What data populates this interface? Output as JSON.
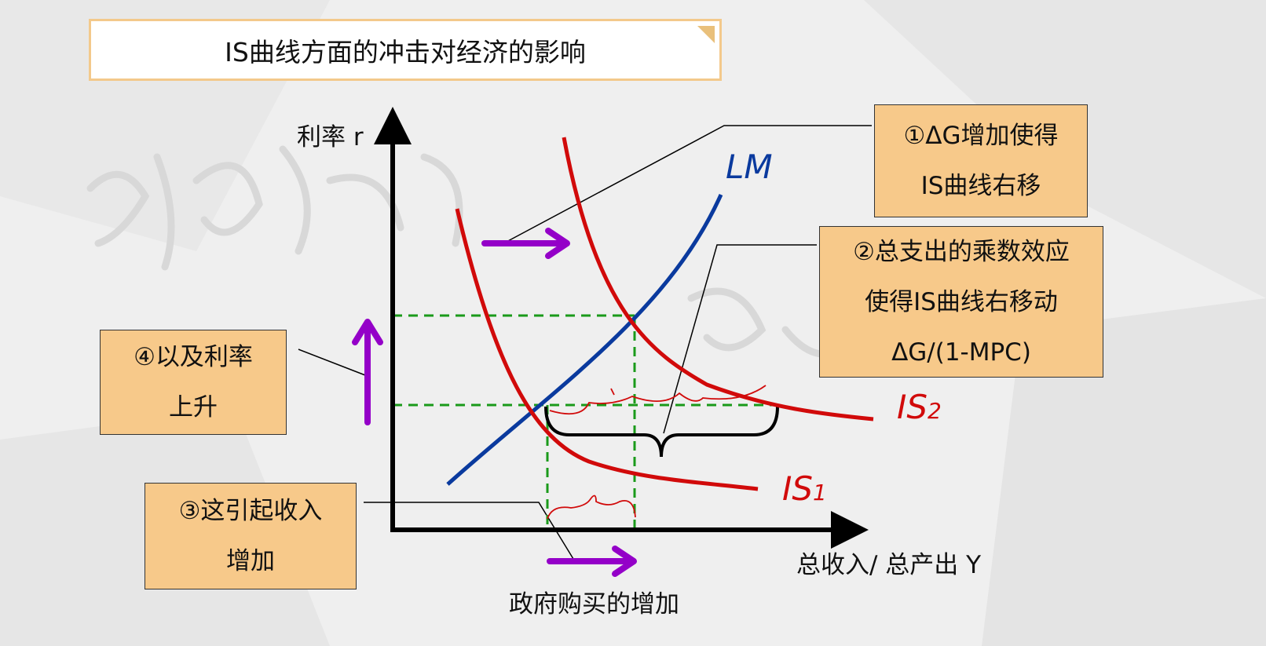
{
  "title": "IS曲线方面的冲击对经济的影响",
  "axes": {
    "y_label": "利率 r",
    "x_label": "总收入/ 总产出 Y"
  },
  "curves": {
    "lm": {
      "label": "LM",
      "color": "#0a3a9e"
    },
    "is1": {
      "label": "IS",
      "subscript": "1",
      "color": "#d10a0a"
    },
    "is2": {
      "label": "IS",
      "subscript": "2",
      "color": "#d10a0a"
    }
  },
  "bottom_caption": "政府购买的增加",
  "notes": {
    "note1": [
      "①ΔG增加使得",
      "IS曲线右移"
    ],
    "note2": [
      "②总支出的乘数效应",
      "使得IS曲线右移动",
      "ΔG/(1-MPC)"
    ],
    "note3": [
      "③这引起收入",
      "增加"
    ],
    "note4": [
      "④以及利率",
      "上升"
    ]
  },
  "colors": {
    "arrow": "#9400c8",
    "guide": "#1a9a1a",
    "note_fill": "#f7c98a",
    "title_border": "#f3c98b"
  }
}
